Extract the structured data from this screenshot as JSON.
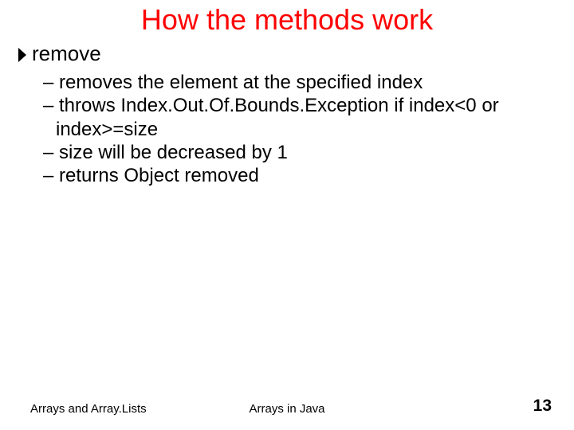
{
  "title": "How the methods work",
  "topic": {
    "label": "remove"
  },
  "sub_items": [
    {
      "dash": "– ",
      "text": "removes the element at the specified index"
    },
    {
      "dash": "– ",
      "text": "throws Index.Out.Of.Bounds.Exception if index<0 or index>=size"
    },
    {
      "dash": "– ",
      "text": "size will be decreased by 1"
    },
    {
      "dash": "– ",
      "text": "returns Object removed"
    }
  ],
  "footer": {
    "left": "Arrays and Array.Lists",
    "center": "Arrays in Java",
    "page": "13"
  }
}
